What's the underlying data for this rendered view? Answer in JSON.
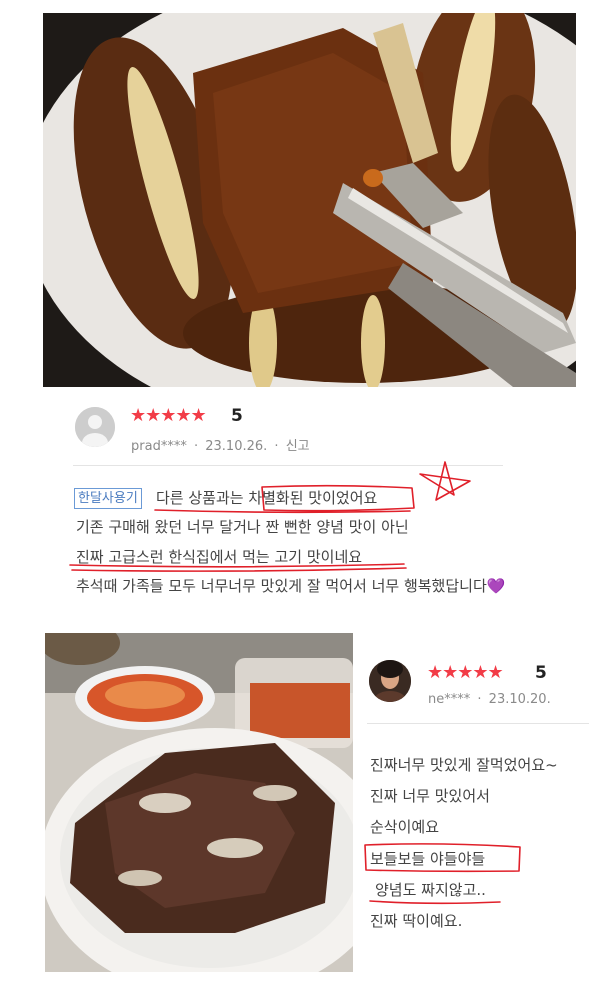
{
  "review1": {
    "rating_stars": "★★★★★",
    "rating": "5",
    "user": "prad****",
    "sep": "·",
    "date": "23.10.26.",
    "report": "신고",
    "badge": "한달사용기",
    "lines": [
      "다른 상품과는 차별화된 맛이었어요",
      "기존 구매해 왔던 너무 달거나 짠  뻔한 양념 맛이 아닌",
      "진짜 고급스런 한식집에서 먹는 고기 맛이네요",
      "추석때 가족들 모두 너무너무 맛있게 잘 먹어서 너무 행복했답니다💜"
    ]
  },
  "review2": {
    "rating_stars": "★★★★★",
    "rating": "5",
    "user": "ne****",
    "sep": "·",
    "date": "23.10.20.",
    "lines": [
      "진짜너무 맛있게 잘먹었어요~",
      "진짜 너무 맛있어서",
      "순삭이예요",
      "보들보들 야들야들",
      "양념도 짜지않고..",
      "진짜 딱이예요."
    ]
  },
  "annotation_color": "#e0202a"
}
